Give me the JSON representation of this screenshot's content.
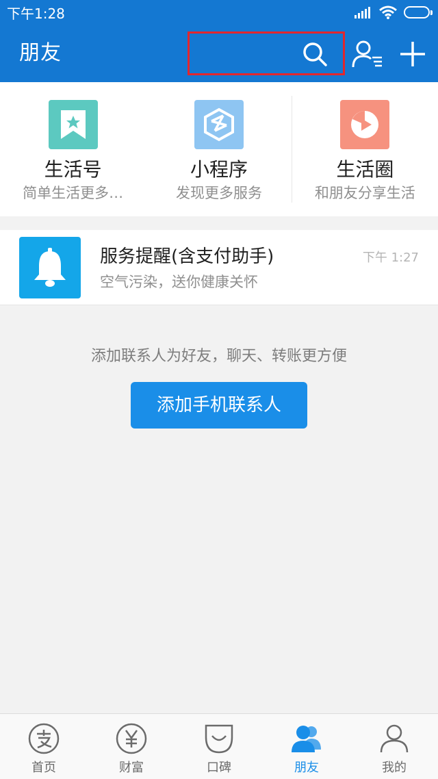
{
  "status_bar": {
    "time": "下午1:28"
  },
  "header": {
    "title": "朋友"
  },
  "shortcuts": [
    {
      "name": "生活号",
      "desc": "简单生活更多…",
      "icon": "bookmark-star-icon",
      "color": "#5cc9c0"
    },
    {
      "name": "小程序",
      "desc": "发现更多服务",
      "icon": "mini-program-icon",
      "color": "#8ec5f2"
    },
    {
      "name": "生活圈",
      "desc": "和朋友分享生活",
      "icon": "play-circle-icon",
      "color": "#f6927f"
    }
  ],
  "notice": {
    "title": "服务提醒(含支付助手)",
    "subtitle": "空气污染，送你健康关怀",
    "time": "下午 1:27"
  },
  "empty_state": {
    "hint": "添加联系人为好友，聊天、转账更方便",
    "button": "添加手机联系人"
  },
  "tabs": [
    {
      "label": "首页",
      "icon": "alipay-icon",
      "active": false
    },
    {
      "label": "财富",
      "icon": "yen-icon",
      "active": false
    },
    {
      "label": "口碑",
      "icon": "koubei-icon",
      "active": false
    },
    {
      "label": "朋友",
      "icon": "friends-icon",
      "active": true
    },
    {
      "label": "我的",
      "icon": "person-icon",
      "active": false
    }
  ],
  "colors": {
    "brand": "#1478d2",
    "highlight": "#e3262d",
    "button": "#1a8ee8"
  }
}
